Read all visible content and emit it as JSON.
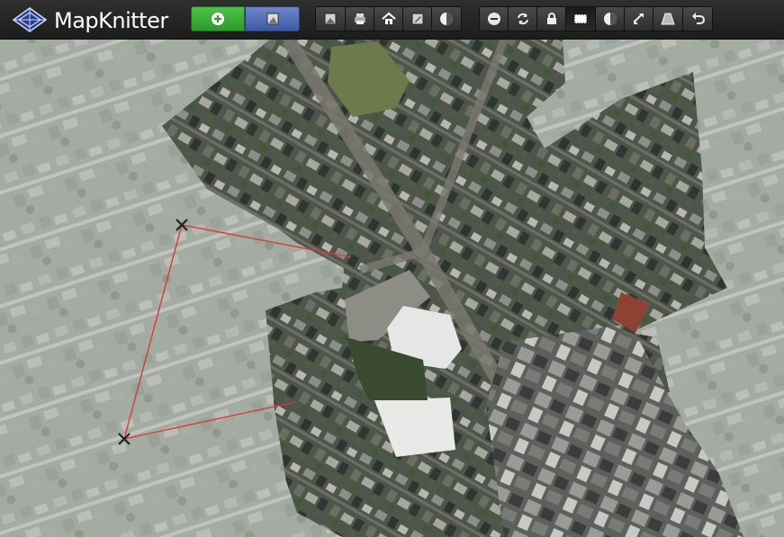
{
  "app": {
    "title": "MapKnitter"
  },
  "colors": {
    "accent_green": "#3aaf38",
    "accent_blue": "#5670b8",
    "toolbar": "#262626",
    "control_line": "#d93a3a"
  },
  "toolbar": {
    "primary": [
      {
        "name": "add-image-button",
        "icon": "plus-circle-icon"
      },
      {
        "name": "image-mode-button",
        "icon": "image-distort-icon"
      }
    ],
    "map_group": [
      {
        "name": "toggle-images-button",
        "icon": "image-icon"
      },
      {
        "name": "print-button",
        "icon": "printer-icon"
      },
      {
        "name": "home-button",
        "icon": "home-icon"
      },
      {
        "name": "edit-image-button",
        "icon": "image-pencil-icon"
      },
      {
        "name": "transparency-button",
        "icon": "half-circle-icon"
      }
    ],
    "image_group": [
      {
        "name": "delete-button",
        "icon": "minus-circle-icon"
      },
      {
        "name": "rotate-button",
        "icon": "rotate-arrows-icon"
      },
      {
        "name": "lock-button",
        "icon": "lock-icon"
      },
      {
        "name": "outline-button",
        "icon": "dashed-rect-icon",
        "active": true
      },
      {
        "name": "opacity-button",
        "icon": "half-circle-icon"
      },
      {
        "name": "distort-button",
        "icon": "distort-arrows-icon"
      },
      {
        "name": "perspective-button",
        "icon": "trapezoid-icon"
      },
      {
        "name": "undo-button",
        "icon": "undo-icon"
      }
    ]
  }
}
